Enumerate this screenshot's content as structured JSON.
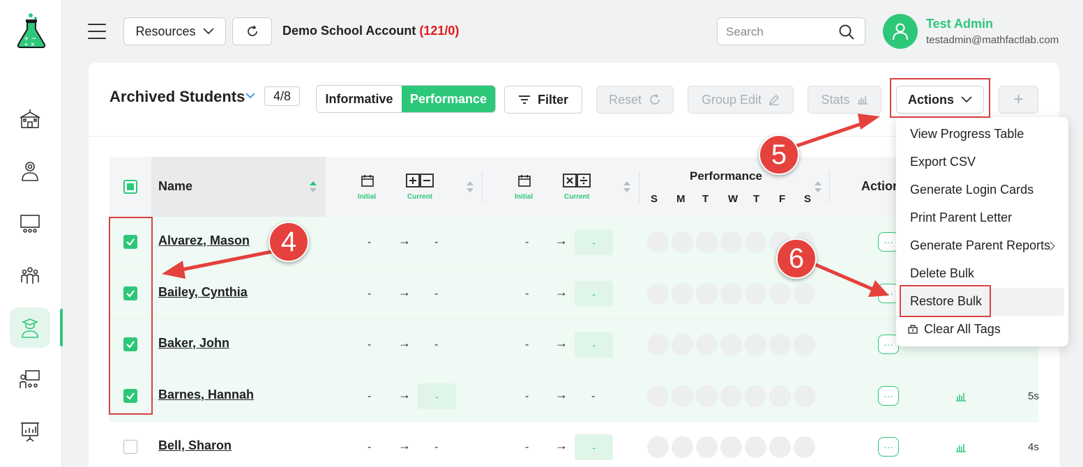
{
  "header": {
    "resources_label": "Resources",
    "account_name": "Demo School Account",
    "account_count": "(121/0)",
    "search_placeholder": "Search",
    "user_name": "Test Admin",
    "user_email": "testadmin@mathfactlab.com"
  },
  "toolbar": {
    "title": "Archived Students",
    "count": "4/8",
    "view_informative": "Informative",
    "view_performance": "Performance",
    "filter_label": "Filter",
    "reset_label": "Reset",
    "group_edit_label": "Group Edit",
    "stats_label": "Stats",
    "actions_label": "Actions",
    "add_label": "+"
  },
  "table": {
    "col_name": "Name",
    "col_performance": "Performance",
    "col_actions": "Action",
    "sub_initial": "Initial",
    "sub_current": "Current",
    "days": [
      "S",
      "M",
      "T",
      "W",
      "T",
      "F",
      "S"
    ],
    "rows": [
      {
        "name": "Alvarez, Mason",
        "checked": true,
        "trail": ""
      },
      {
        "name": "Bailey, Cynthia",
        "checked": true,
        "trail": ""
      },
      {
        "name": "Baker, John",
        "checked": true,
        "trail": ""
      },
      {
        "name": "Barnes, Hannah",
        "checked": true,
        "trail": "5s"
      },
      {
        "name": "Bell, Sharon",
        "checked": false,
        "trail": "4s"
      }
    ],
    "dash": "-",
    "more": "···"
  },
  "actions_menu": {
    "items": [
      "View Progress Table",
      "Export CSV",
      "Generate Login Cards",
      "Print Parent Letter",
      "Generate Parent Reports",
      "Delete Bulk",
      "Restore Bulk",
      "Clear All Tags"
    ]
  },
  "annotations": {
    "step4": "4",
    "step5": "5",
    "step6": "6"
  },
  "colors": {
    "brand_green": "#2dc77a",
    "annotation_red": "#e5413d",
    "count_red": "#e01b1b"
  }
}
